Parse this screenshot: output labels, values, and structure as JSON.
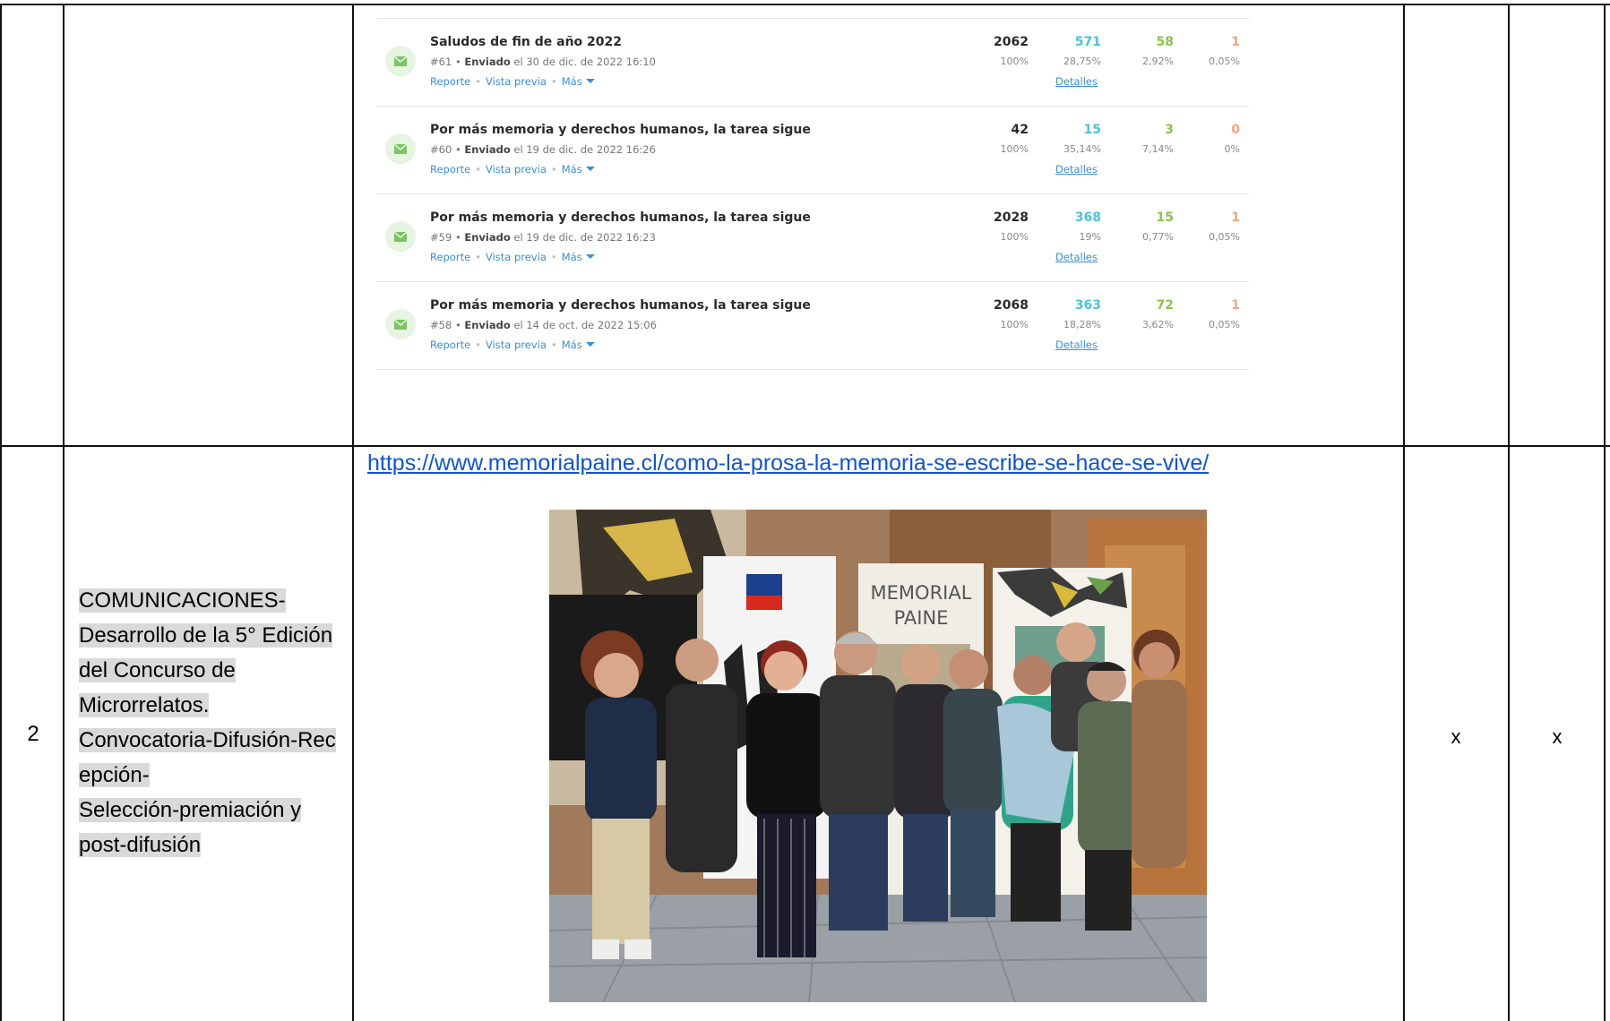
{
  "report": {
    "rows": [
      {
        "title": "Saludos de fin de año 2022",
        "id": "#61",
        "status": "Enviado",
        "date": "el 30 de dic. de 2022 16:10",
        "sent": "2062",
        "sent_pct": "100%",
        "opened": "571",
        "opened_pct": "28,75%",
        "clicked": "58",
        "clicked_pct": "2,92%",
        "bounced": "1",
        "bounced_pct": "0,05%"
      },
      {
        "title": "Por más memoria y derechos humanos, la tarea sigue",
        "id": "#60",
        "status": "Enviado",
        "date": "el 19 de dic. de 2022 16:26",
        "sent": "42",
        "sent_pct": "100%",
        "opened": "15",
        "opened_pct": "35,14%",
        "clicked": "3",
        "clicked_pct": "7,14%",
        "bounced": "0",
        "bounced_pct": "0%"
      },
      {
        "title": "Por más memoria y derechos humanos, la tarea sigue",
        "id": "#59",
        "status": "Enviado",
        "date": "el 19 de dic. de 2022 16:23",
        "sent": "2028",
        "sent_pct": "100%",
        "opened": "368",
        "opened_pct": "19%",
        "clicked": "15",
        "clicked_pct": "0,77%",
        "bounced": "1",
        "bounced_pct": "0,05%"
      },
      {
        "title": "Por más memoria y derechos humanos, la tarea sigue",
        "id": "#58",
        "status": "Enviado",
        "date": "el 14 de oct. de 2022 15:06",
        "sent": "2068",
        "sent_pct": "100%",
        "opened": "363",
        "opened_pct": "18,28%",
        "clicked": "72",
        "clicked_pct": "3,62%",
        "bounced": "1",
        "bounced_pct": "0,05%"
      }
    ],
    "link_report": "Reporte",
    "link_preview": "Vista previa",
    "link_more": "Más",
    "link_details": "Detalles",
    "bullet": "•",
    "colors": {
      "opened": "#4fc1d8",
      "clicked": "#8bc34a",
      "bounced": "#f0a67a",
      "link": "#3b8fd6"
    }
  },
  "row2": {
    "number": "2",
    "activity_lines": [
      "COMUNICACIONES-",
      "Desarrollo de la 5° Edición",
      "del Concurso de",
      "Microrrelatos.",
      "Convocatoria-Difusión-Rec",
      "epción-",
      "Selección-premiación y",
      "post-difusión"
    ],
    "url": "https://www.memorialpaine.cl/como-la-prosa-la-memoria-se-escribe-se-hace-se-vive/",
    "banner_memorial_line1": "MEMORIAL",
    "banner_memorial_line2": "PAINE",
    "mark_1": "x",
    "mark_2": "x"
  }
}
